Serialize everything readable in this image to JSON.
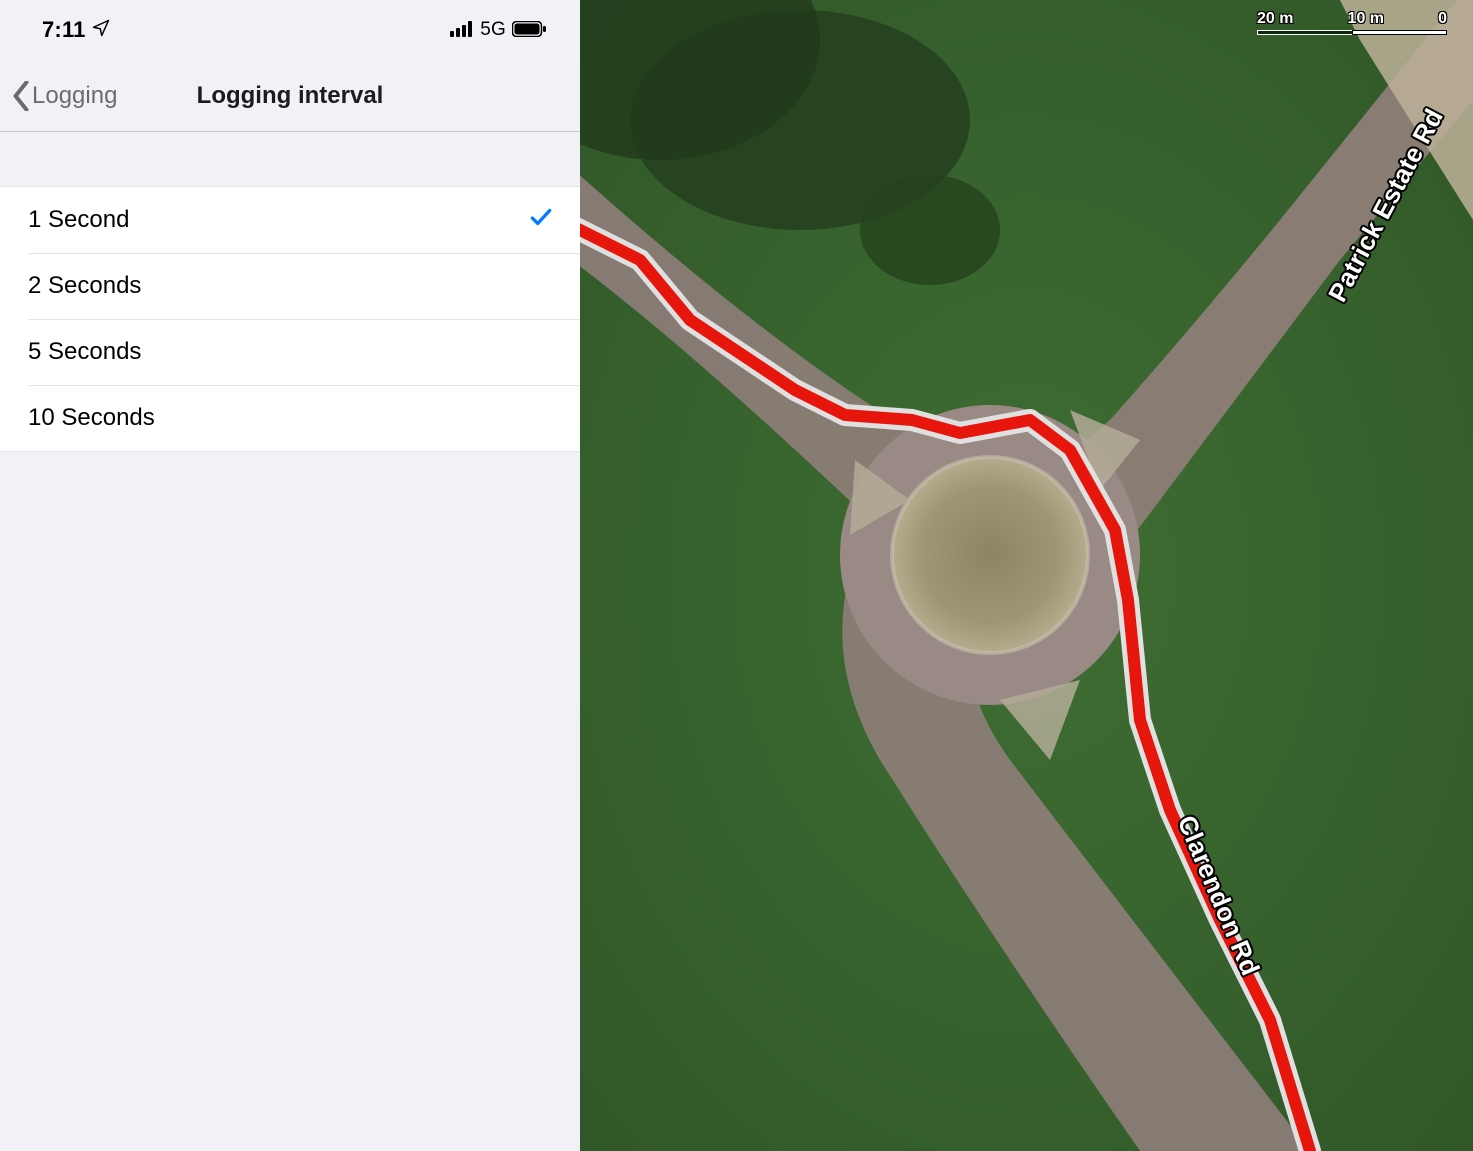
{
  "status_bar": {
    "time": "7:11",
    "network_type": "5G"
  },
  "nav": {
    "back_label": "Logging",
    "title": "Logging interval"
  },
  "options": [
    {
      "label": "1 Second",
      "selected": true
    },
    {
      "label": "2 Seconds",
      "selected": false
    },
    {
      "label": "5 Seconds",
      "selected": false
    },
    {
      "label": "10 Seconds",
      "selected": false
    }
  ],
  "map": {
    "scale": {
      "left": "20 m",
      "mid": "10 m",
      "right": "0"
    },
    "roads": [
      {
        "name": "Patrick Estate Rd"
      },
      {
        "name": "Clarendon Rd"
      }
    ],
    "track_color": "#e6160d",
    "track_halo": "#e0e0e0"
  }
}
